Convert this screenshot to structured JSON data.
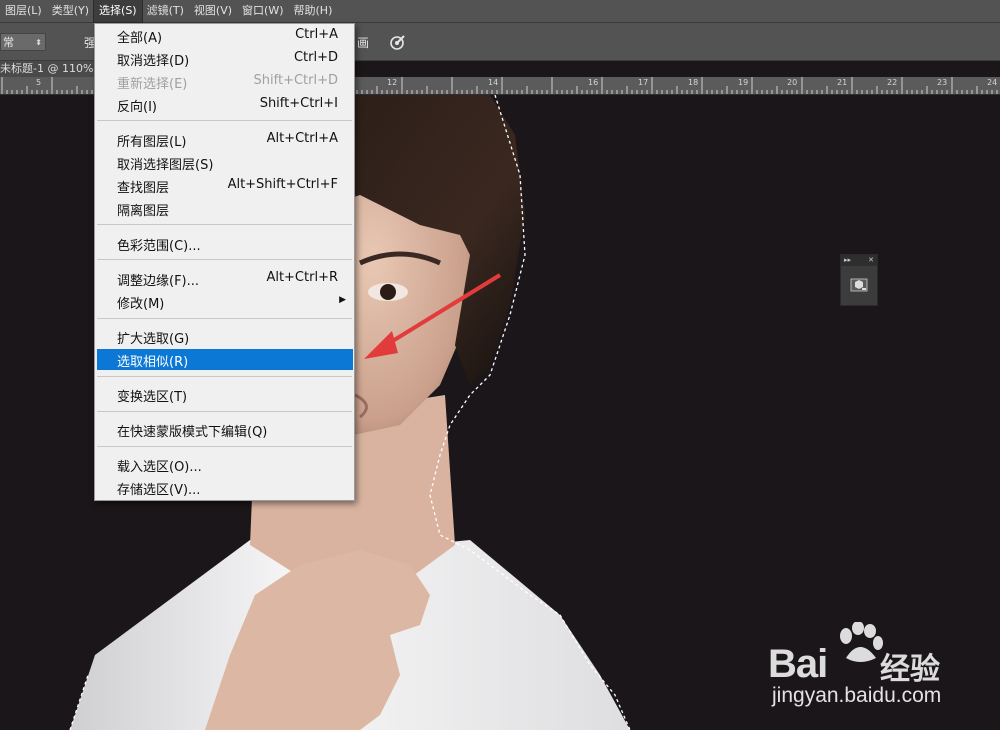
{
  "menubar": {
    "items": [
      {
        "label": "图层(L)"
      },
      {
        "label": "类型(Y)"
      },
      {
        "label": "选择(S)",
        "active": true
      },
      {
        "label": "滤镜(T)"
      },
      {
        "label": "视图(V)"
      },
      {
        "label": "窗口(W)"
      },
      {
        "label": "帮助(H)"
      }
    ]
  },
  "options_bar": {
    "blend_mode": "常",
    "strength_label": "强",
    "sample_label": "画"
  },
  "document": {
    "tab_title": "未标题-1 @ 110%"
  },
  "ruler": {
    "ticks": [
      "5",
      "12",
      "14",
      "16",
      "17",
      "18",
      "19",
      "20",
      "21",
      "22",
      "23",
      "24"
    ]
  },
  "select_menu": {
    "items": [
      {
        "label": "全部(A)",
        "shortcut": "Ctrl+A"
      },
      {
        "label": "取消选择(D)",
        "shortcut": "Ctrl+D"
      },
      {
        "label": "重新选择(E)",
        "shortcut": "Shift+Ctrl+D",
        "disabled": true
      },
      {
        "label": "反向(I)",
        "shortcut": "Shift+Ctrl+I"
      },
      {
        "label": "所有图层(L)",
        "shortcut": "Alt+Ctrl+A"
      },
      {
        "label": "取消选择图层(S)",
        "shortcut": ""
      },
      {
        "label": "查找图层",
        "shortcut": "Alt+Shift+Ctrl+F"
      },
      {
        "label": "隔离图层",
        "shortcut": ""
      },
      {
        "label": "色彩范围(C)...",
        "shortcut": ""
      },
      {
        "label": "调整边缘(F)...",
        "shortcut": "Alt+Ctrl+R"
      },
      {
        "label": "修改(M)",
        "shortcut": "",
        "submenu": true
      },
      {
        "label": "扩大选取(G)",
        "shortcut": ""
      },
      {
        "label": "选取相似(R)",
        "shortcut": "",
        "highlighted": true
      },
      {
        "label": "变换选区(T)",
        "shortcut": ""
      },
      {
        "label": "在快速蒙版模式下编辑(Q)",
        "shortcut": ""
      },
      {
        "label": "载入选区(O)...",
        "shortcut": ""
      },
      {
        "label": "存储选区(V)...",
        "shortcut": ""
      }
    ]
  },
  "panel": {
    "expand_glyph": "▸▸",
    "close_glyph": "✕"
  },
  "watermark": {
    "brand": "Bai",
    "brand_suffix": "经验",
    "url": "jingyan.baidu.com"
  },
  "colors": {
    "menubar_bg": "#535353",
    "canvas_bg": "#1b1619",
    "highlight": "#0b78d6",
    "arrow": "#e23b3b"
  },
  "icons": {
    "brush": "brush-pressure-icon",
    "panel": "3d-cube-icon",
    "annotation": "red-arrow-icon",
    "paw": "baidu-paw-icon"
  }
}
